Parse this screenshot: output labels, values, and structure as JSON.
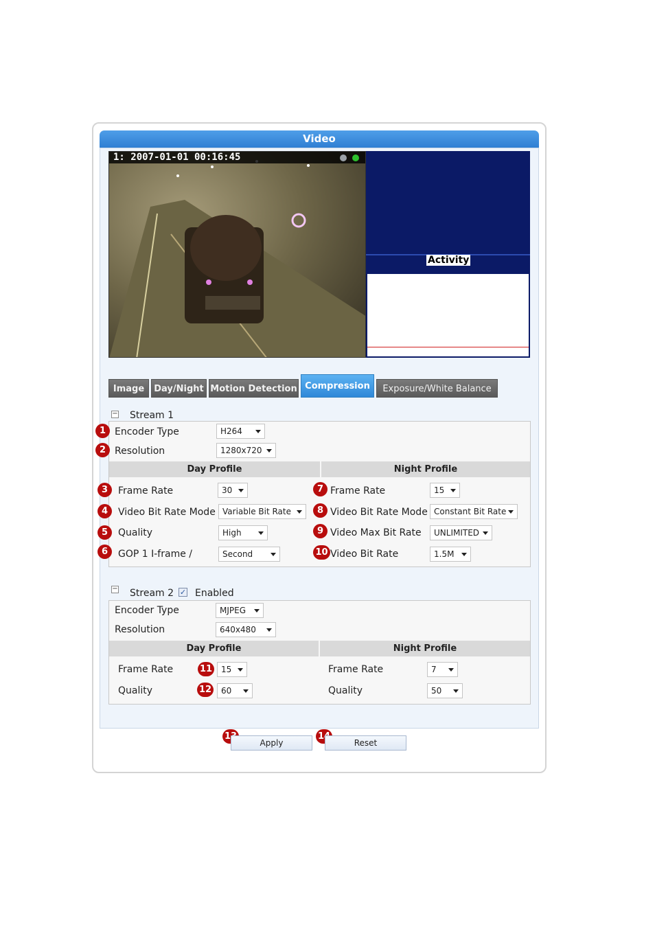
{
  "window": {
    "title": "Video"
  },
  "video": {
    "osd_text": "1:  2007-01-01 00:16:45"
  },
  "activity": {
    "label": "Activity"
  },
  "tabs": [
    {
      "label": "Image"
    },
    {
      "label": "Day/Night"
    },
    {
      "label": "Motion Detection"
    },
    {
      "label": "Compression",
      "active": true
    },
    {
      "label": "Exposure/White Balance"
    }
  ],
  "stream1": {
    "title": "Stream 1",
    "encoder_label": "Encoder Type",
    "encoder_value": "H264",
    "resolution_label": "Resolution",
    "resolution_value": "1280x720",
    "day_header": "Day Profile",
    "night_header": "Night Profile",
    "day": {
      "frame_rate_label": "Frame Rate",
      "frame_rate_value": "30",
      "bitrate_mode_label": "Video Bit Rate Mode",
      "bitrate_mode_value": "Variable Bit Rate",
      "quality_label": "Quality",
      "quality_value": "High",
      "gop_label": "GOP 1 I-frame /",
      "gop_value": "Second"
    },
    "night": {
      "frame_rate_label": "Frame Rate",
      "frame_rate_value": "15",
      "bitrate_mode_label": "Video Bit Rate Mode",
      "bitrate_mode_value": "Constant Bit Rate",
      "max_bitrate_label": "Video Max Bit Rate",
      "max_bitrate_value": "UNLIMITED",
      "bitrate_label": "Video Bit Rate",
      "bitrate_value": "1.5M"
    }
  },
  "stream2": {
    "title": "Stream 2",
    "enabled_label": "Enabled",
    "enabled": true,
    "encoder_label": "Encoder Type",
    "encoder_value": "MJPEG",
    "resolution_label": "Resolution",
    "resolution_value": "640x480",
    "day_header": "Day Profile",
    "night_header": "Night Profile",
    "day": {
      "frame_rate_label": "Frame Rate",
      "frame_rate_value": "15",
      "quality_label": "Quality",
      "quality_value": "60"
    },
    "night": {
      "frame_rate_label": "Frame Rate",
      "frame_rate_value": "7",
      "quality_label": "Quality",
      "quality_value": "50"
    }
  },
  "badges": [
    "1",
    "2",
    "3",
    "4",
    "5",
    "6",
    "7",
    "8",
    "9",
    "10",
    "11",
    "12",
    "13",
    "14"
  ],
  "buttons": {
    "apply": "Apply",
    "reset": "Reset"
  },
  "colors": {
    "title_bar": "#3b8ddc",
    "active_tab": "#3d96e0",
    "badge": "#b80d0d",
    "activity_bg": "#0b1a66"
  },
  "indicator_icons": [
    "gray-dot-icon",
    "green-dot-icon"
  ],
  "collapse_icons": [
    "minus-box-icon"
  ],
  "checkbox_icons": [
    "checkmark-icon"
  ]
}
